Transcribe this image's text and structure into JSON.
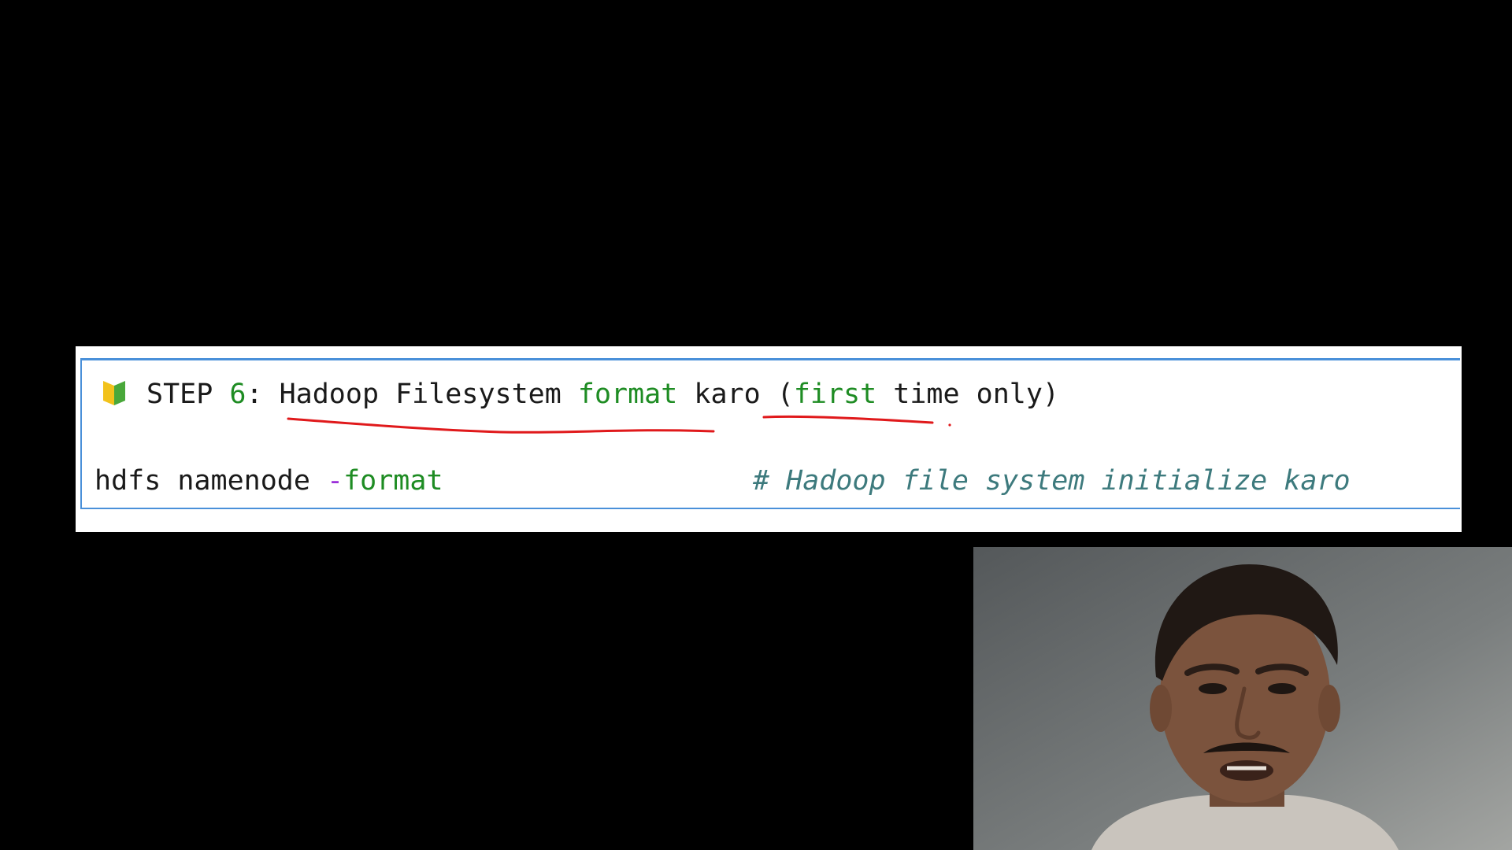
{
  "code_block": {
    "heading": {
      "icon": "beginner-badge-icon",
      "step_word": "STEP ",
      "step_number": "6",
      "colon": ": ",
      "text_a": "Hadoop Filesystem ",
      "text_format": "format",
      "text_b": " karo (",
      "text_first": "first",
      "text_c": " time only)"
    },
    "command": {
      "program": "hdfs namenode ",
      "flag_dash": "-",
      "flag_name": "format"
    },
    "comment": "# Hadoop file system initialize karo"
  },
  "annotations": {
    "pen_color": "#e0191b"
  },
  "webcam": {
    "icon": "presenter-video-icon"
  },
  "colors": {
    "background": "#000000",
    "panel": "#ffffff",
    "frame_border": "#4a90d9",
    "keyword_green": "#1e8c23",
    "flag_purple": "#9b30d9",
    "comment_teal": "#3d7a7d"
  }
}
